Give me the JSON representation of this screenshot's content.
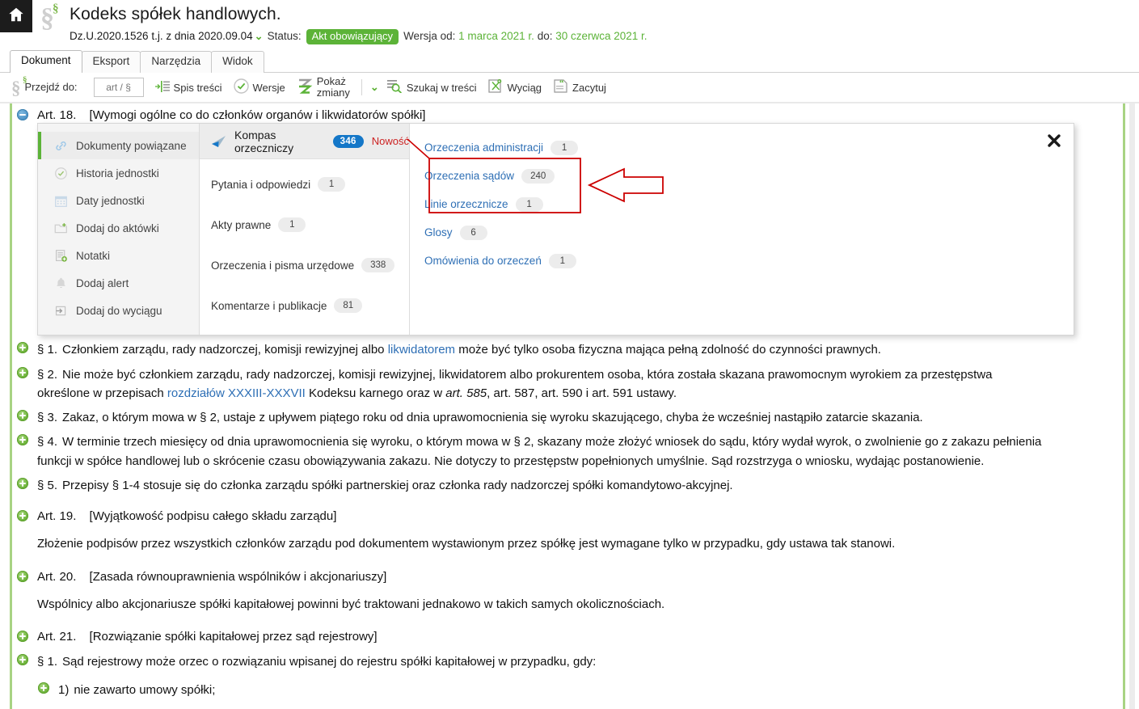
{
  "header": {
    "home_icon": "home-icon",
    "section_symbol": "§",
    "title": "Kodeks spółek handlowych.",
    "signature": "Dz.U.2020.1526 t.j. z dnia 2020.09.04",
    "signature_caret": "❯",
    "status_label": "Status:",
    "status_value": "Akt obowiązujący",
    "version_label": "Wersja od:",
    "version_from": "1 marca 2021 r.",
    "version_to_label": "do:",
    "version_to": "30 czerwca 2021 r."
  },
  "tabs": [
    {
      "label": "Dokument",
      "active": true
    },
    {
      "label": "Eksport",
      "active": false
    },
    {
      "label": "Narzędzia",
      "active": false
    },
    {
      "label": "Widok",
      "active": false
    }
  ],
  "toolbar": {
    "goto_label": "Przejdź do:",
    "goto_placeholder": "art / §",
    "goto_value": "",
    "toc_label": "Spis treści",
    "versions_label": "Wersje",
    "show_changes_label_1": "Pokaż",
    "show_changes_label_2": "zmiany",
    "caret": "❯",
    "search_in_content_label": "Szukaj w treści",
    "extract_label": "Wyciąg",
    "cite_label": "Zacytuj"
  },
  "popup": {
    "close_icon": "close-icon",
    "left_items": [
      {
        "label": "Dokumenty powiązane",
        "icon": "link-icon",
        "active": true
      },
      {
        "label": "Historia jednostki",
        "icon": "clock-check-icon",
        "active": false
      },
      {
        "label": "Daty jednostki",
        "icon": "calendar-icon",
        "active": false
      },
      {
        "label": "Dodaj do aktówki",
        "icon": "folder-add-icon",
        "active": false
      },
      {
        "label": "Notatki",
        "icon": "note-add-icon",
        "active": false
      },
      {
        "label": "Dodaj alert",
        "icon": "bell-icon",
        "active": false
      },
      {
        "label": "Dodaj do wyciągu",
        "icon": "arrow-into-box-icon",
        "active": false
      }
    ],
    "mid_header": {
      "icon": "compass-arrow-icon",
      "title": "Kompas orzeczniczy",
      "count": "346",
      "new_flag": "Nowość"
    },
    "mid_rows": [
      {
        "label": "Pytania i odpowiedzi",
        "count": "1"
      },
      {
        "label": "Akty prawne",
        "count": "1"
      },
      {
        "label": "Orzeczenia i pisma urzędowe",
        "count": "338"
      },
      {
        "label": "Komentarze i publikacje",
        "count": "81"
      }
    ],
    "right_rows": [
      {
        "label": "Orzeczenia administracji",
        "count": "1"
      },
      {
        "label": "Orzeczenia sądów",
        "count": "240"
      },
      {
        "label": "Linie orzecznicze",
        "count": "1"
      },
      {
        "label": "Glosy",
        "count": "6"
      },
      {
        "label": "Omówienia do orzeczeń",
        "count": "1"
      }
    ]
  },
  "annotation": {
    "highlight_color": "#cc0000",
    "arrow": "left-pointing-arrow"
  },
  "document": {
    "art18": {
      "prefix": "Art.",
      "number": "18.",
      "name": "[Wymogi ogólne co do członków organów i likwidatorów spółki]"
    },
    "paragraphs": [
      {
        "mark": "§ 1.",
        "text_a": "Członkiem zarządu, rady nadzorczej, komisji rewizyjnej albo ",
        "link": "likwidatorem",
        "text_b": " może być tylko osoba fizyczna mająca pełną zdolność do czynności prawnych."
      },
      {
        "mark": "§ 2.",
        "text_a": "Nie może być członkiem zarządu, rady nadzorczej, komisji rewizyjnej, likwidatorem albo prokurentem osoba, która została skazana prawomocnym wyrokiem za przestępstwa określone w przepisach ",
        "link": "rozdziałów XXXIII-XXXVII",
        "text_b": " Kodeksu karnego oraz w ",
        "italic": "art. 585",
        "text_c": ", art. 587, art. 590 i art. 591 ustawy."
      },
      {
        "mark": "§ 3.",
        "text_a": "Zakaz, o którym mowa w § 2, ustaje z upływem piątego roku od dnia uprawomocnienia się wyroku skazującego, chyba że wcześniej nastąpiło zatarcie skazania."
      },
      {
        "mark": "§ 4.",
        "text_a": "W terminie trzech miesięcy od dnia uprawomocnienia się wyroku, o którym mowa w § 2, skazany może złożyć wniosek do sądu, który wydał wyrok, o zwolnienie go z zakazu pełnienia funkcji w spółce handlowej lub o skrócenie czasu obowiązywania zakazu. Nie dotyczy to przestępstw popełnionych umyślnie. Sąd rozstrzyga o wniosku, wydając postanowienie."
      },
      {
        "mark": "§ 5.",
        "text_a": "Przepisy § 1-4 stosuje się do członka zarządu spółki partnerskiej oraz członka rady nadzorczej spółki komandytowo-akcyjnej."
      }
    ],
    "art19": {
      "prefix": "Art.",
      "number": "19.",
      "name": "[Wyjątkowość podpisu całego składu zarządu]",
      "body": "Złożenie podpisów przez wszystkich członków zarządu pod dokumentem wystawionym przez spółkę jest wymagane tylko w przypadku, gdy ustawa tak stanowi."
    },
    "art20": {
      "prefix": "Art.",
      "number": "20.",
      "name": "[Zasada równouprawnienia wspólników i akcjonariuszy]",
      "body": "Wspólnicy albo akcjonariusze spółki kapitałowej powinni być traktowani jednakowo w takich samych okolicznościach."
    },
    "art21": {
      "prefix": "Art.",
      "number": "21.",
      "name": "[Rozwiązanie spółki kapitałowej przez sąd rejestrowy]",
      "p1_mark": "§ 1.",
      "p1_text": "Sąd rejestrowy może orzec o rozwiązaniu wpisanej do rejestru spółki kapitałowej w przypadku, gdy:",
      "i1_mark": "1)",
      "i1_text": "nie zawarto umowy spółki;"
    }
  }
}
